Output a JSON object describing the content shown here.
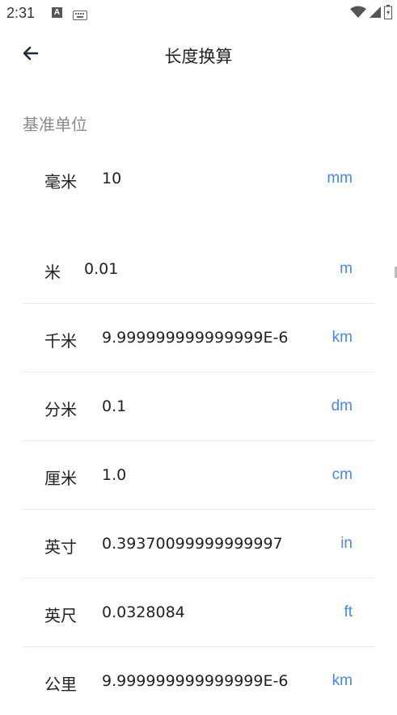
{
  "status_bar": {
    "time": "2:31",
    "icons": [
      "a-icon",
      "keyboard-icon",
      "wifi-icon",
      "signal-icon",
      "battery-icon"
    ]
  },
  "app_bar": {
    "title": "长度换算",
    "back_icon": "back-arrow-icon"
  },
  "base_section": {
    "label": "基准单位",
    "base_unit": {
      "name": "毫米",
      "value": "10",
      "unit": "mm"
    }
  },
  "conversions": [
    {
      "name": "米",
      "value": "0.01",
      "unit": "m"
    },
    {
      "name": "千米",
      "value": "9.999999999999999E-6",
      "unit": "km"
    },
    {
      "name": "分米",
      "value": "0.1",
      "unit": "dm"
    },
    {
      "name": "厘米",
      "value": "1.0",
      "unit": "cm"
    },
    {
      "name": "英寸",
      "value": "0.39370099999999997",
      "unit": "in"
    },
    {
      "name": "英尺",
      "value": "0.0328084",
      "unit": "ft"
    },
    {
      "name": "公里",
      "value": "9.999999999999999E-6",
      "unit": "km"
    }
  ],
  "colors": {
    "accent": "#4a86e8",
    "section_label": "#8a8a8a",
    "divider": "#ececec"
  }
}
